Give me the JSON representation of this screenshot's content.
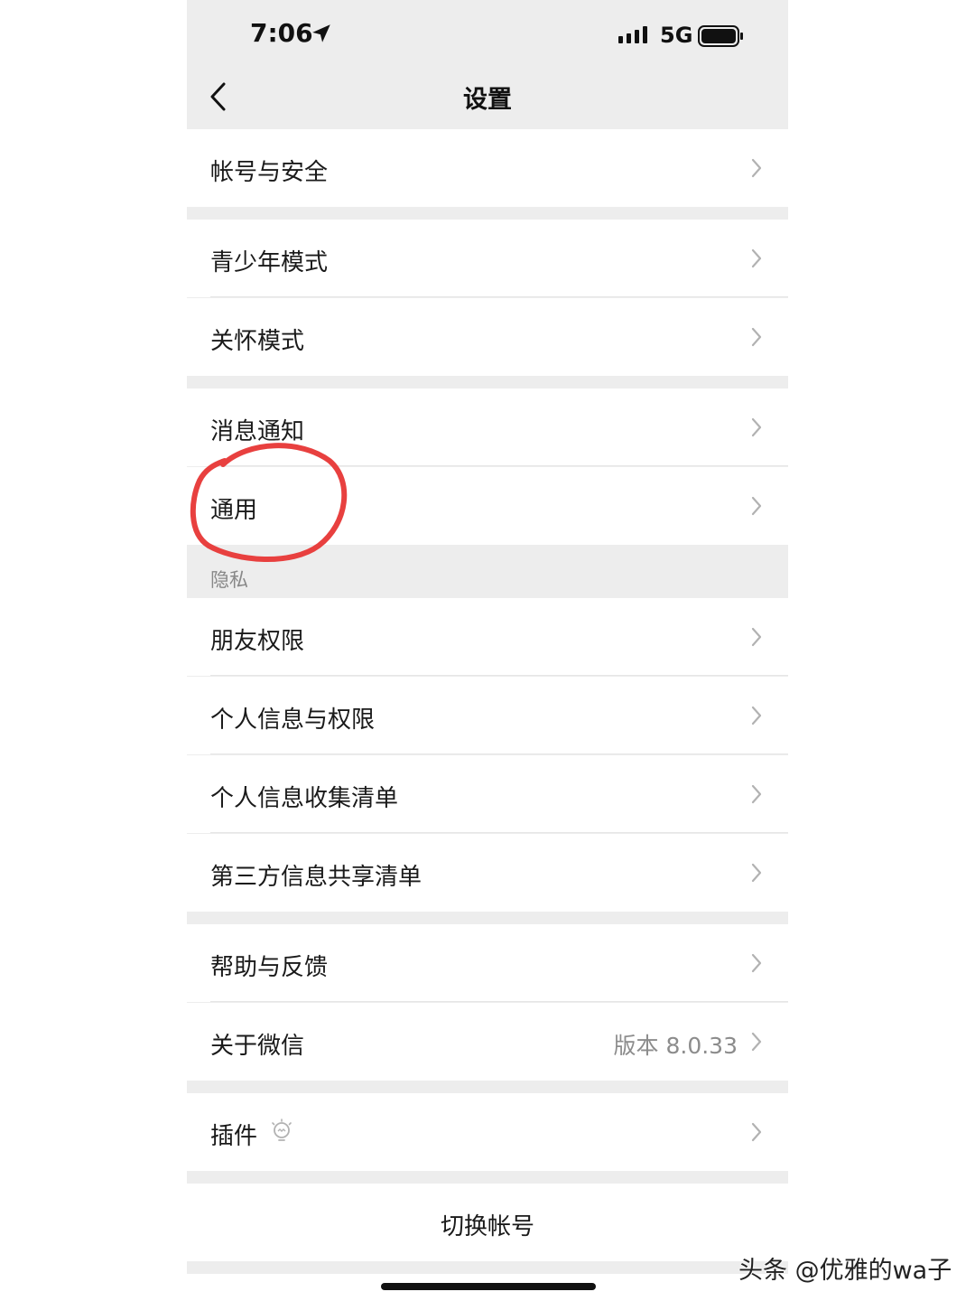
{
  "status_bar": {
    "time": "7:06",
    "network": "5G",
    "icons": [
      "location-arrow-icon",
      "signal-icon",
      "battery-icon"
    ]
  },
  "nav": {
    "title": "设置",
    "back_icon": "chevron-left-icon"
  },
  "rows": {
    "account_security": "帐号与安全",
    "teen_mode": "青少年模式",
    "care_mode": "关怀模式",
    "notifications": "消息通知",
    "general": "通用",
    "friend_permissions": "朋友权限",
    "personal_info_permissions": "个人信息与权限",
    "personal_info_collection": "个人信息收集清单",
    "third_party_sharing": "第三方信息共享清单",
    "help_feedback": "帮助与反馈",
    "about_wechat": "关于微信",
    "plugins": "插件",
    "switch_account": "切换帐号"
  },
  "about_wechat_value": "版本 8.0.33",
  "section_privacy": "隐私",
  "annotation": {
    "circle_color": "#e8403f",
    "circled_item": "通用"
  },
  "watermark": "头条 @优雅的wa子",
  "colors": {
    "background": "#ededed",
    "row_background": "#ffffff",
    "text": "#1a1a1a",
    "secondary_text": "#8c8c8c",
    "chevron": "#b2b2b2"
  }
}
